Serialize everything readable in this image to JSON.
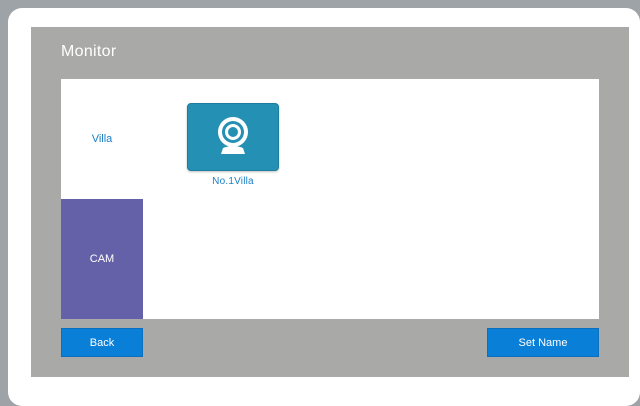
{
  "header": {
    "title": "Monitor"
  },
  "sidebar": {
    "tabs": [
      {
        "label": "Villa",
        "selected": false
      },
      {
        "label": "CAM",
        "selected": true
      }
    ]
  },
  "devices": [
    {
      "label": "No.1Villa",
      "icon": "webcam-icon"
    }
  ],
  "footer": {
    "back_label": "Back",
    "set_name_label": "Set Name"
  },
  "colors": {
    "frame_background": "#a9aaa7",
    "content_background": "#ffffff",
    "selected_tab": "#6561a8",
    "button": "#0a7fd8",
    "device_icon": "#2490b3",
    "link_text": "#1a7fc4"
  }
}
